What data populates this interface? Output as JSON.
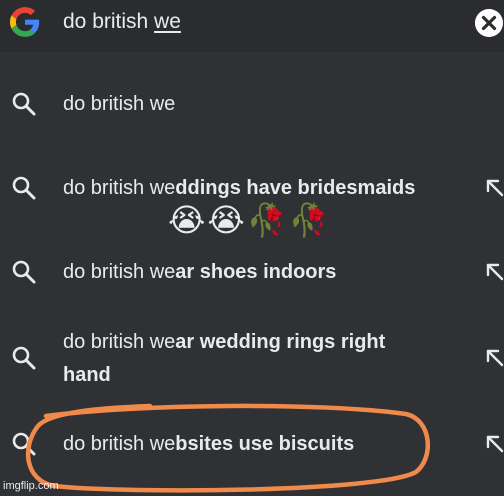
{
  "search": {
    "typed_prefix": "do british ",
    "typed_suffix": "we"
  },
  "suggestions": [
    {
      "prefix": "do british we",
      "rest": ""
    },
    {
      "prefix": "do british we",
      "rest": "ddings have bridesmaids"
    },
    {
      "prefix": "do british we",
      "rest": "ar shoes indoors"
    },
    {
      "prefix": "do british we",
      "rest": "ar wedding rings right"
    },
    {
      "prefix": "",
      "rest": "hand"
    },
    {
      "prefix": "do british we",
      "rest": "bsites use biscuits"
    }
  ],
  "emoji_reaction": [
    "😭",
    "😭",
    "🥀",
    "🥀"
  ],
  "annotation": {
    "circle_color": "#f08a4b"
  },
  "watermark": "imgflip.com",
  "icons": {
    "logo": "google-g-icon",
    "clear": "close-icon",
    "row": "search-icon",
    "fill": "arrow-up-left-icon"
  },
  "colors": {
    "background": "#303135",
    "text": "#e8eaed",
    "google_blue": "#4285F4",
    "google_red": "#EA4335",
    "google_yellow": "#FBBC05",
    "google_green": "#34A853"
  }
}
